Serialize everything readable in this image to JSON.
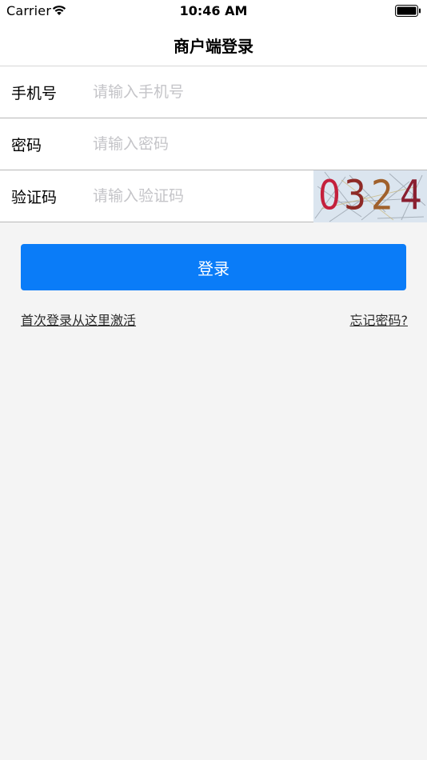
{
  "status_bar": {
    "carrier": "Carrier",
    "time": "10:46 AM"
  },
  "nav": {
    "title": "商户端登录"
  },
  "form": {
    "phone": {
      "label": "手机号",
      "placeholder": "请输入手机号",
      "value": ""
    },
    "password": {
      "label": "密码",
      "placeholder": "请输入密码",
      "value": ""
    },
    "captcha": {
      "label": "验证码",
      "placeholder": "请输入验证码",
      "value": "",
      "image_text": "0324"
    }
  },
  "login_button": {
    "label": "登录"
  },
  "links": {
    "activate": "首次登录从这里激活",
    "forgot": "忘记密码?"
  },
  "colors": {
    "accent": "#0a7cf8",
    "background": "#f4f4f4"
  },
  "icons": {
    "wifi": "wifi-icon",
    "battery": "battery-icon"
  }
}
